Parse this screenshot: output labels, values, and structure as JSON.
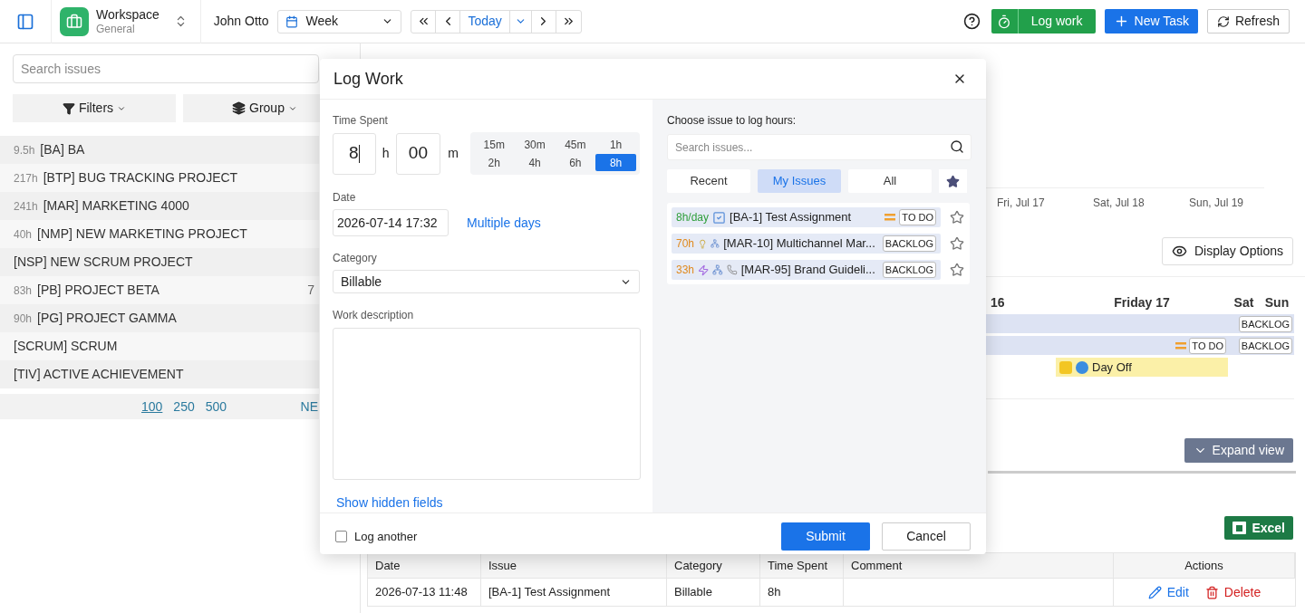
{
  "header": {
    "workspace": {
      "name": "Workspace",
      "subtitle": "General"
    },
    "user": "John Otto",
    "view_select": "Week",
    "today": "Today",
    "log_work": "Log work",
    "new_task": "New Task",
    "refresh": "Refresh"
  },
  "sidebar": {
    "search_placeholder": "Search issues",
    "filters": "Filters",
    "group": "Group",
    "projects": [
      {
        "hours": "9.5h",
        "name": "[BA] BA"
      },
      {
        "hours": "217h",
        "name": "[BTP] BUG TRACKING PROJECT"
      },
      {
        "hours": "241h",
        "name": "[MAR] MARKETING 4000"
      },
      {
        "hours": "40h",
        "name": "[NMP] NEW MARKETING PROJECT"
      },
      {
        "name": "[NSP] NEW SCRUM PROJECT"
      },
      {
        "hours": "83h",
        "name": "[PB] PROJECT BETA",
        "column_2": "7"
      },
      {
        "hours": "90h",
        "name": "[PG] PROJECT GAMMA"
      },
      {
        "name": "[SCRUM] SCRUM"
      },
      {
        "name": "[TIV] ACTIVE ACHIEVEMENT"
      }
    ],
    "page_sizes": [
      {
        "label": "100",
        "selected": true
      },
      {
        "label": "250",
        "selected": false
      },
      {
        "label": "500",
        "selected": false
      }
    ],
    "next": "NE"
  },
  "week_header": [
    "Fri, Jul 17",
    "Sat, Jul 18",
    "Sun, Jul 19"
  ],
  "display_options": "Display Options",
  "calendar": {
    "days": [
      "16",
      "Friday 17",
      "Sat",
      "Sun"
    ],
    "bars": [
      {
        "kind": "wide",
        "status": "BACKLOG"
      },
      {
        "kind": "flagged",
        "status": "TO DO"
      },
      {
        "kind": "short",
        "status": "BACKLOG"
      },
      {
        "kind": "event",
        "label": "Day Off"
      }
    ]
  },
  "expand_view": "Expand view",
  "excel": "Excel",
  "table": {
    "columns": [
      "Date",
      "Issue",
      "Category",
      "Time Spent",
      "Comment",
      "Actions"
    ],
    "rows": [
      {
        "cells": [
          "2026-07-13 11:48",
          "[BA-1] Test Assignment",
          "Billable",
          "8h",
          ""
        ],
        "edit": "Edit",
        "delete": "Delete"
      }
    ]
  },
  "modal": {
    "title": "Log Work",
    "time_spent": {
      "label": "Time Spent",
      "hours": "8",
      "hours_unit": "h",
      "minutes": "00",
      "minutes_unit": "m",
      "presets": [
        {
          "label": "15m",
          "selected": false
        },
        {
          "label": "30m",
          "selected": false
        },
        {
          "label": "45m",
          "selected": false
        },
        {
          "label": "1h",
          "selected": false
        },
        {
          "label": "2h",
          "selected": false
        },
        {
          "label": "4h",
          "selected": false
        },
        {
          "label": "6h",
          "selected": false
        },
        {
          "label": "8h",
          "selected": true
        }
      ]
    },
    "date": {
      "label": "Date",
      "value": "2026-07-14 17:32",
      "link": "Multiple days"
    },
    "category": {
      "label": "Category",
      "value": "Billable"
    },
    "description": {
      "label": "Work description"
    },
    "show_hidden": "Show hidden fields",
    "log_another": {
      "label": "Log another",
      "checked": false
    },
    "submit": "Submit",
    "cancel": "Cancel",
    "issue_picker": {
      "label": "Choose issue to log hours:",
      "search_placeholder": "Search issues...",
      "tabs": [
        {
          "label": "Recent",
          "selected": false
        },
        {
          "label": "My Issues",
          "selected": true
        },
        {
          "label": "All",
          "selected": false
        }
      ],
      "issues": [
        {
          "hours": "8h/day",
          "color": "#2e9e3a",
          "kind": "task",
          "title": "[BA-1] Test Assignment",
          "status": "TO DO",
          "starred": false
        },
        {
          "hours": "70h",
          "color": "#e08a1e",
          "kind": "idea",
          "title": "[MAR-10] Multichannel Mar...",
          "status": "BACKLOG",
          "starred": false
        },
        {
          "hours": "33h",
          "color": "#e08a1e",
          "kind": "epic",
          "title": "[MAR-95] Brand Guideli...",
          "status": "BACKLOG",
          "starred": false
        }
      ]
    }
  }
}
